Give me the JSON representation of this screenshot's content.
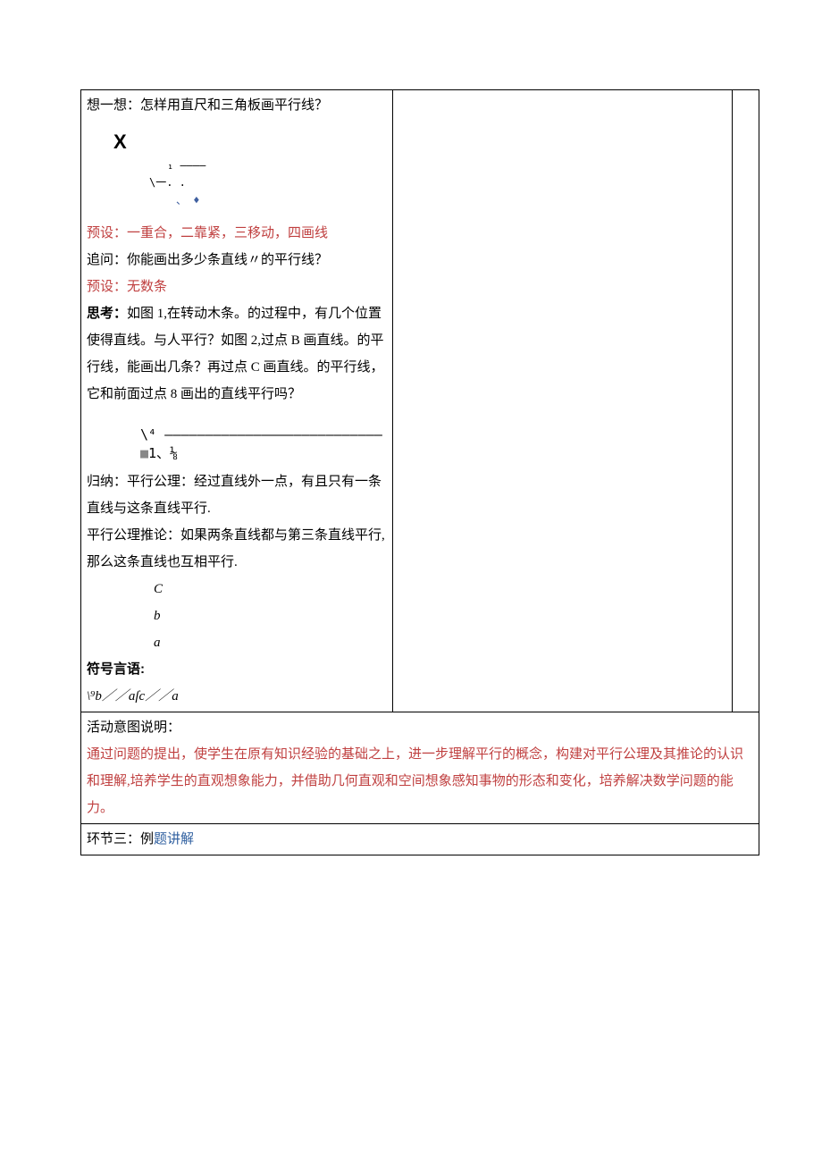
{
  "main": {
    "think_prompt": "想一想：怎样用直尺和三角板画平行线？",
    "figure1": {
      "x": "X",
      "mid": "₁ ––––",
      "low": "\\一. .",
      "last": "、 ♦"
    },
    "preset1": "预设：一重合，二靠紧，三移动，四画线",
    "followup_label": "追问：",
    "followup_text": "你能画出多少条直线〃的平行线？",
    "preset2": "预设：无数条",
    "think2_label": "思考：",
    "think2_text": "如图 1,在转动木条。的过程中，有几个位置使得直线。与人平行？如图 2,过点 B 画直线。的平行线，能画出几条？再过点 C 画直线。的平行线，它和前面过点 8 画出的直线平行吗？",
    "figure2": {
      "top": "\\⁴ –––––––––––––––––––––––––––",
      "bottom": "■1、⅛"
    },
    "induce_label": "归纳：",
    "induce_text": "平行公理：经过直线外一点，有且只有一条直线与这条直线平行.",
    "corollary": "平行公理推论：如果两条直线都与第三条直线平行,那么这条直线也互相平行.",
    "letters": {
      "c": "C",
      "b": "b",
      "a": "a"
    },
    "symbol_label": "符号言语:",
    "symbol_expr": "\\⁹b／／aſc／／a"
  },
  "intent": {
    "label": "活动意图说明：",
    "body": "通过问题的提出，使学生在原有知识经验的基础之上，进一步理解平行的概念，构建对平行公理及其推论的认识和理解,培养学生的直观想象能力，并借助几何直观和空间想象感知事物的形态和变化，培养解决数学问题的能力。"
  },
  "section3": {
    "prefix": "环节三：例",
    "link": "题讲解"
  }
}
